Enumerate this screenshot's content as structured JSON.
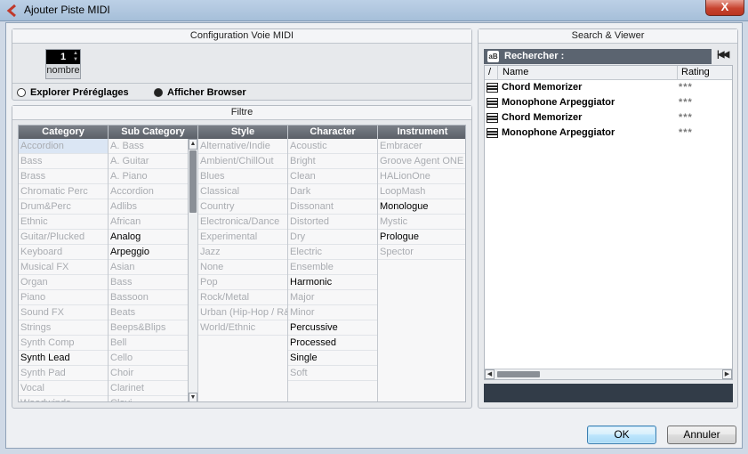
{
  "window": {
    "title": "Ajouter Piste MIDI",
    "close_label": "X"
  },
  "config": {
    "title": "Configuration Voie MIDI",
    "count_value": "1",
    "count_label": "nombre",
    "radio_presets": "Explorer Préréglages",
    "radio_browser": "Afficher Browser",
    "selected_radio": "browser"
  },
  "filter": {
    "title": "Filtre",
    "columns": [
      {
        "header": "Category",
        "items": [
          "Accordion",
          "Bass",
          "Brass",
          "Chromatic Perc",
          "Drum&Perc",
          "Ethnic",
          "Guitar/Plucked",
          "Keyboard",
          "Musical FX",
          "Organ",
          "Piano",
          "Sound FX",
          "Strings",
          "Synth Comp",
          "Synth Lead",
          "Synth Pad",
          "Vocal",
          "Woodwinds"
        ],
        "active": [
          14
        ],
        "selected": [
          0
        ]
      },
      {
        "header": "Sub Category",
        "items": [
          "A. Bass",
          "A. Guitar",
          "A. Piano",
          "Accordion",
          "Adlibs",
          "African",
          "Analog",
          "Arpeggio",
          "Asian",
          "Bass",
          "Bassoon",
          "Beats",
          "Beeps&Blips",
          "Bell",
          "Cello",
          "Choir",
          "Clarinet",
          "Clavi"
        ],
        "active": [
          6,
          7
        ],
        "selected": []
      },
      {
        "header": "Style",
        "items": [
          "Alternative/Indie",
          "Ambient/ChillOut",
          "Blues",
          "Classical",
          "Country",
          "Electronica/Dance",
          "Experimental",
          "Jazz",
          "None",
          "Pop",
          "Rock/Metal",
          "Urban (Hip-Hop / R&B)",
          "World/Ethnic"
        ],
        "active": [],
        "selected": []
      },
      {
        "header": "Character",
        "items": [
          "Acoustic",
          "Bright",
          "Clean",
          "Dark",
          "Dissonant",
          "Distorted",
          "Dry",
          "Electric",
          "Ensemble",
          "Harmonic",
          "Major",
          "Minor",
          "Percussive",
          "Processed",
          "Single",
          "Soft"
        ],
        "active": [
          9,
          12,
          13,
          14
        ],
        "selected": []
      },
      {
        "header": "Instrument",
        "items": [
          "Embracer",
          "Groove Agent ONE",
          "HALionOne",
          "LoopMash",
          "Monologue",
          "Mystic",
          "Prologue",
          "Spector"
        ],
        "active": [
          4,
          6
        ],
        "selected": []
      }
    ]
  },
  "search": {
    "title": "Search & Viewer",
    "search_label": "Rechercher :",
    "col_sort": "/",
    "col_name": "Name",
    "col_rating": "Rating",
    "results": [
      {
        "name": "Chord Memorizer",
        "rating": "***"
      },
      {
        "name": "Monophone Arpeggiator",
        "rating": "***"
      },
      {
        "name": "Chord Memorizer",
        "rating": "***"
      },
      {
        "name": "Monophone Arpeggiator",
        "rating": "***"
      }
    ]
  },
  "buttons": {
    "ok": "OK",
    "cancel": "Annuler"
  }
}
